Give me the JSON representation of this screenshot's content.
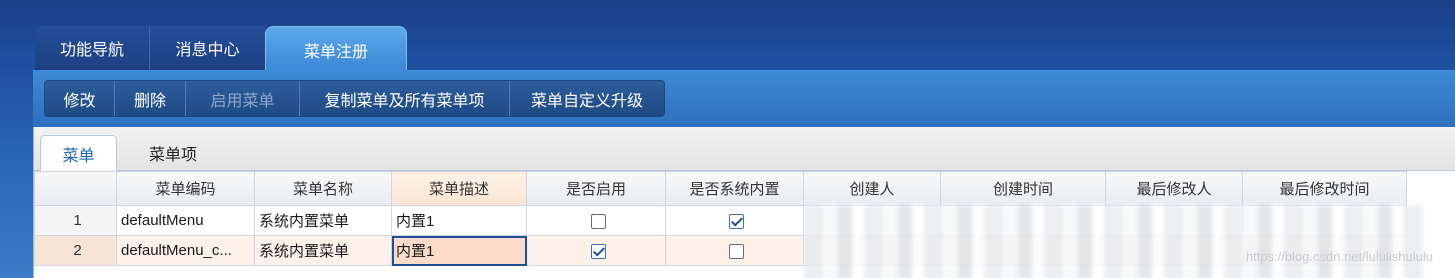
{
  "top_tabs": [
    "功能导航",
    "消息中心",
    "菜单注册"
  ],
  "toolbar": {
    "buttons": [
      "修改",
      "删除",
      "启用菜单",
      "复制菜单及所有菜单项",
      "菜单自定义升级"
    ]
  },
  "sub_tabs": [
    "菜单",
    "菜单项"
  ],
  "grid": {
    "headers": [
      "",
      "菜单编码",
      "菜单名称",
      "菜单描述",
      "是否启用",
      "是否系统内置",
      "创建人",
      "创建时间",
      "最后修改人",
      "最后修改时间"
    ],
    "rows": [
      {
        "num": "1",
        "code": "defaultMenu",
        "name": "系统内置菜单",
        "desc": "内置1",
        "enabled": false,
        "builtin": true
      },
      {
        "num": "2",
        "code": "defaultMenu_c...",
        "name": "系统内置菜单",
        "desc": "内置1",
        "enabled": true,
        "builtin": false
      }
    ]
  },
  "watermark": "https://blog.csdn.net/lululishululu"
}
